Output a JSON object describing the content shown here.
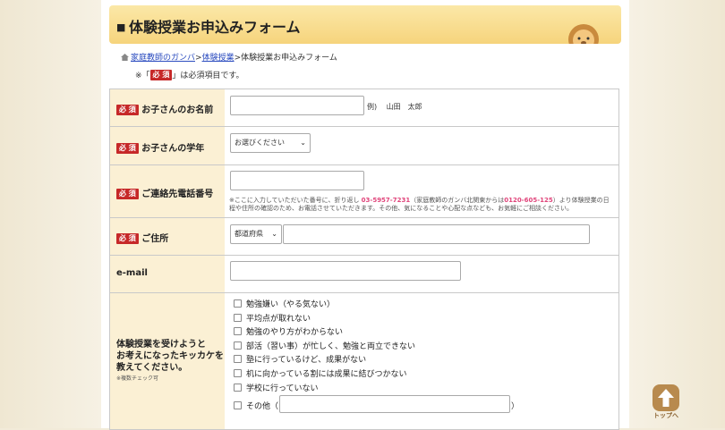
{
  "banner": {
    "marker": "■",
    "title": "体験授業お申込みフォーム"
  },
  "breadcrumb": {
    "home": "家庭教師のガンバ",
    "sep1": ">",
    "level2": "体験授業",
    "sep2": ">",
    "current": "体験授業お申込みフォーム"
  },
  "note": {
    "prefix": "※「",
    "badge": "必 須",
    "suffix": "」は必須項目です。"
  },
  "required_badge": "必 須",
  "form": {
    "child_name": {
      "label": "お子さんのお名前",
      "example": "例)　 山田　太郎",
      "value": ""
    },
    "grade": {
      "label": "お子さんの学年",
      "selected": "お選びください"
    },
    "phone": {
      "label": "ご連絡先電話番号",
      "value": "",
      "note_a": "※ここに入力していただいた番号に、折り返し ",
      "tel1": "03-5957-7231",
      "note_b": "（家庭教師のガンバ北関東からは",
      "tel2": "0120-605-125",
      "note_c": "）より体験授業の日程や住所の確認のため、お電話させていただきます。その他、気になることや心配な点なども、お気軽にご相談ください。"
    },
    "address": {
      "label": "ご住所",
      "prefecture": "都道府県",
      "value": ""
    },
    "email": {
      "label": "e-mail",
      "value": ""
    },
    "reason": {
      "label_line1": "体験授業を受けようと",
      "label_line2": "お考えになったキッカケを",
      "label_line3": "教えてください。",
      "label_small": "※複数チェック可",
      "options": [
        "勉強嫌い（やる気ない）",
        "平均点が取れない",
        "勉強のやり方がわからない",
        "部活（習い事）が忙しく、勉強と両立できない",
        "塾に行っているけど、成果がない",
        "机に向かっている割には成果に結びつかない",
        "学校に行っていない"
      ],
      "other_label": "その他（",
      "other_close": "）",
      "other_value": ""
    }
  },
  "top_button": {
    "label": "トップへ"
  },
  "colors": {
    "accent": "#c62828",
    "label_bg": "#fbf0d4",
    "banner": "#f6d47c",
    "link": "#2a4bbf",
    "tel": "#e0457b",
    "top_button": "#b88a4e"
  },
  "icons": {
    "breadcrumb_home": "home-icon",
    "banner_mascot": "lion-mascot-icon",
    "top_button": "arrow-up-icon",
    "select": "chevron-down-icon"
  }
}
